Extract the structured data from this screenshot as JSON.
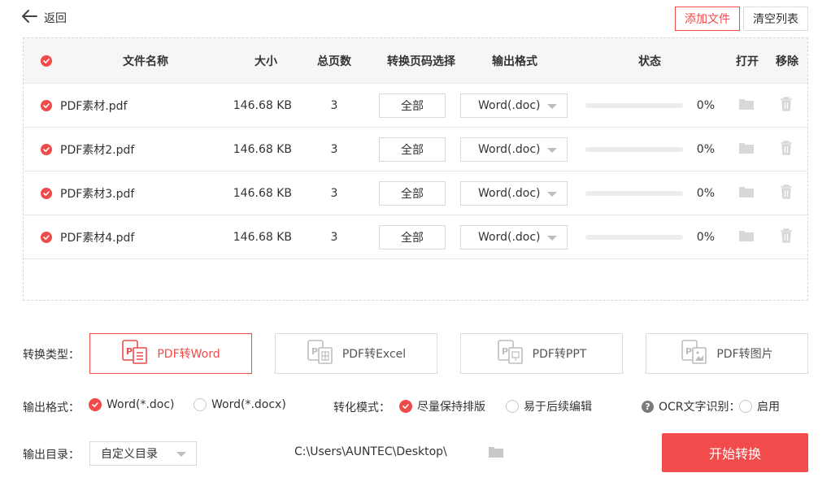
{
  "header": {
    "back_label": "返回",
    "add_file_label": "添加文件",
    "clear_list_label": "清空列表"
  },
  "table": {
    "columns": {
      "name": "文件名称",
      "size": "大小",
      "pages": "总页数",
      "page_select": "转换页码选择",
      "format": "输出格式",
      "status": "状态",
      "open": "打开",
      "remove": "移除"
    },
    "rows": [
      {
        "name": "PDF素材.pdf",
        "size": "146.68 KB",
        "pages": "3",
        "page_select": "全部",
        "format": "Word(.doc)",
        "progress": 0,
        "percent": "0%"
      },
      {
        "name": "PDF素材2.pdf",
        "size": "146.68 KB",
        "pages": "3",
        "page_select": "全部",
        "format": "Word(.doc)",
        "progress": 0,
        "percent": "0%"
      },
      {
        "name": "PDF素材3.pdf",
        "size": "146.68 KB",
        "pages": "3",
        "page_select": "全部",
        "format": "Word(.doc)",
        "progress": 0,
        "percent": "0%"
      },
      {
        "name": "PDF素材4.pdf",
        "size": "146.68 KB",
        "pages": "3",
        "page_select": "全部",
        "format": "Word(.doc)",
        "progress": 0,
        "percent": "0%"
      }
    ]
  },
  "convert_type": {
    "label": "转换类型：",
    "options": [
      {
        "label": "PDF转Word",
        "active": true
      },
      {
        "label": "PDF转Excel",
        "active": false
      },
      {
        "label": "PDF转PPT",
        "active": false
      },
      {
        "label": "PDF转图片",
        "active": false
      }
    ]
  },
  "output_format": {
    "label": "输出格式：",
    "options": [
      {
        "label": "Word(*.doc)",
        "selected": true
      },
      {
        "label": "Word(*.docx)",
        "selected": false
      }
    ]
  },
  "convert_mode": {
    "label": "转化模式：",
    "options": [
      {
        "label": "尽量保持排版",
        "selected": true
      },
      {
        "label": "易于后续编辑",
        "selected": false
      }
    ]
  },
  "ocr": {
    "label": "OCR文字识别：",
    "enable_label": "启用",
    "help_glyph": "?"
  },
  "output_dir": {
    "label": "输出目录：",
    "selected": "自定义目录",
    "path": "C:\\Users\\AUNTEC\\Desktop\\"
  },
  "start_button_label": "开始转换",
  "colors": {
    "accent": "#f04a4a",
    "border": "#d9d9d9",
    "header_bg": "#f6f6f6"
  }
}
